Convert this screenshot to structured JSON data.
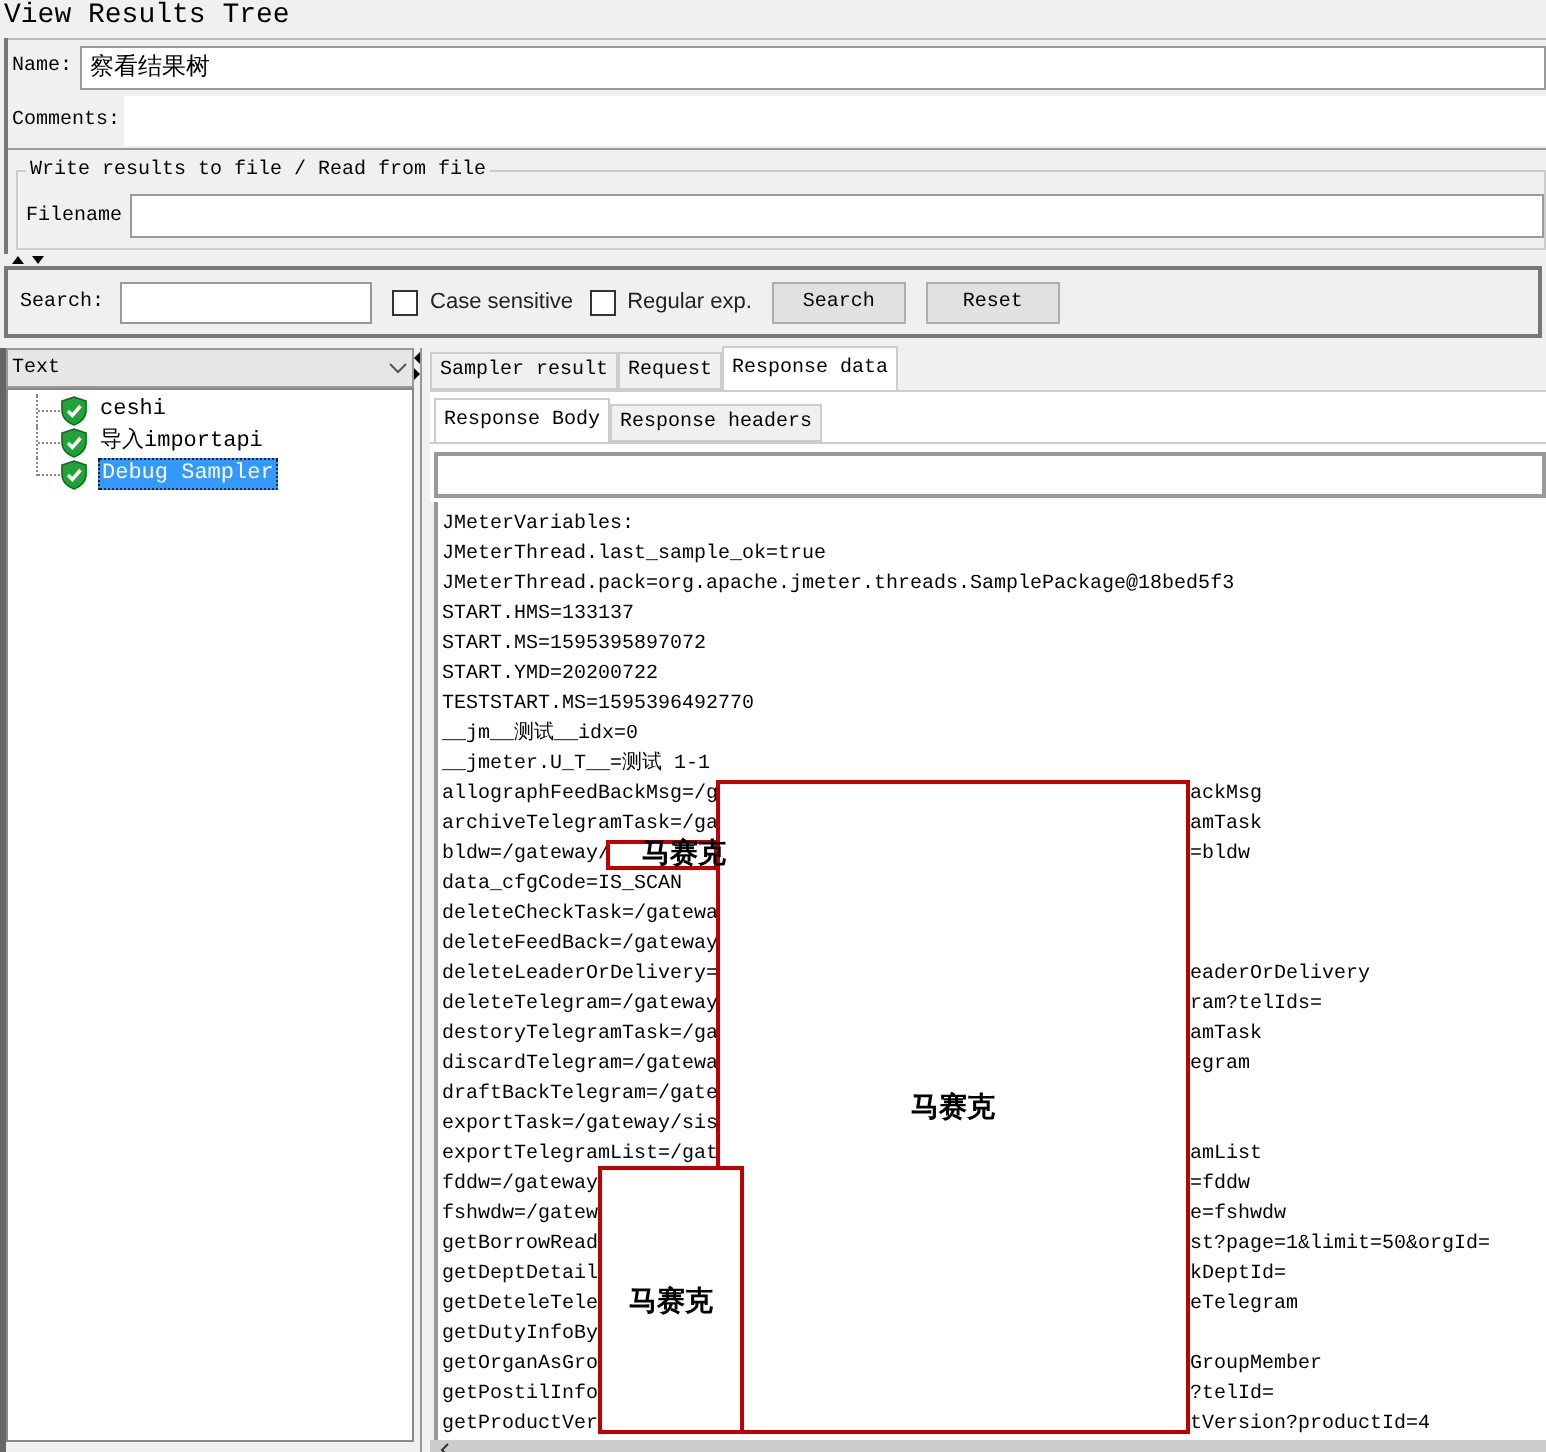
{
  "window": {
    "title": "View Results Tree"
  },
  "name_field": {
    "label": "Name:",
    "value": "察看结果树"
  },
  "comments_field": {
    "label": "Comments:"
  },
  "file_group": {
    "title": "Write results to file / Read from file",
    "filename_label": "Filename"
  },
  "search_bar": {
    "label": "Search:",
    "options": [
      {
        "label": "Case sensitive",
        "checked": false
      },
      {
        "label": "Regular exp.",
        "checked": false
      }
    ],
    "buttons": [
      "Search",
      "Reset"
    ]
  },
  "renderer_select": {
    "value": "Text"
  },
  "tree": {
    "items": [
      {
        "label": "ceshi",
        "selected": false,
        "kind": "success"
      },
      {
        "label": "导入importapi",
        "selected": false,
        "kind": "success"
      },
      {
        "label": "Debug Sampler",
        "selected": true,
        "kind": "success"
      }
    ]
  },
  "tabs": [
    {
      "label": "Sampler result",
      "selected": false
    },
    {
      "label": "Request",
      "selected": false
    },
    {
      "label": "Response data",
      "selected": true
    }
  ],
  "sub_tabs": [
    {
      "label": "Response Body",
      "selected": true
    },
    {
      "label": "Response headers",
      "selected": false
    }
  ],
  "response_lines": [
    {
      "text": "JMeterVariables:"
    },
    {
      "text": "JMeterThread.last_sample_ok=true"
    },
    {
      "text": "JMeterThread.pack=org.apache.jmeter.threads.SamplePackage@18bed5f3"
    },
    {
      "text": "START.HMS=133137"
    },
    {
      "text": "START.MS=1595395897072"
    },
    {
      "text": "START.YMD=20200722"
    },
    {
      "text": "TESTSTART.MS=1595396492770"
    },
    {
      "text": "__jm__测试__idx=0"
    },
    {
      "text": "__jmeter.U_T__=测试 1-1"
    },
    {
      "text": "allographFeedBackMsg=/g",
      "tail": "ackMsg"
    },
    {
      "text": "archiveTelegramTask=/ga",
      "tail": "amTask"
    },
    {
      "text": "bldw=/gateway/",
      "tail": "=bldw"
    },
    {
      "text": "data_cfgCode=IS_SCAN"
    },
    {
      "text": "deleteCheckTask=/gatewa"
    },
    {
      "text": "deleteFeedBack=/gateway"
    },
    {
      "text": "deleteLeaderOrDelivery=",
      "tail": "eaderOrDelivery"
    },
    {
      "text": "deleteTelegram=/gateway",
      "tail": "ram?telIds="
    },
    {
      "text": "destoryTelegramTask=/ga",
      "tail": "amTask"
    },
    {
      "text": "discardTelegram=/gatewa",
      "tail": "egram"
    },
    {
      "text": "draftBackTelegram=/gate"
    },
    {
      "text": "exportTask=/gateway/sis"
    },
    {
      "text": "exportTelegramList=/gat",
      "tail": "amList"
    },
    {
      "text": "fddw=/gateway",
      "tail": "=fddw"
    },
    {
      "text": "fshwdw=/gatew",
      "tail": "e=fshwdw"
    },
    {
      "text": "getBorrowRead",
      "tail": "st?page=1&limit=50&orgId="
    },
    {
      "text": "getDeptDetail",
      "tail": "kDeptId="
    },
    {
      "text": "getDeteleTele",
      "tail": "eTelegram"
    },
    {
      "text": "getDutyInfoBy"
    },
    {
      "text": "getOrganAsGro",
      "tail": "GroupMember"
    },
    {
      "text": "getPostilInfo",
      "tail": "?telId="
    },
    {
      "text": "getProductVer",
      "tail": "tVersion?productId=4"
    }
  ],
  "overlays": [
    {
      "label": "马赛克"
    },
    {
      "label": "马赛克"
    },
    {
      "label": "马赛克"
    }
  ]
}
